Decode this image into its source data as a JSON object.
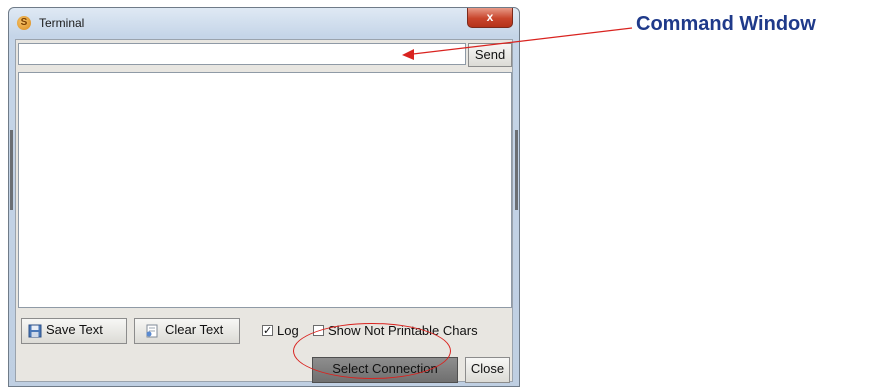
{
  "window": {
    "title": "Terminal",
    "app_icon": "terminal-app-icon",
    "close_icon_label": "x"
  },
  "command": {
    "value": "",
    "placeholder": "",
    "send_label": "Send"
  },
  "output": {
    "text": ""
  },
  "toolbar": {
    "save_label": "Save Text",
    "save_icon": "floppy-disk-icon",
    "clear_label": "Clear Text",
    "clear_icon": "clear-document-icon",
    "log_label": "Log",
    "log_checked": true,
    "show_np_label": "Show Not Printable Chars",
    "show_np_checked": false
  },
  "footer": {
    "select_label": "Select Connection",
    "close_label": "Close"
  },
  "annotation": {
    "label": "Command Window",
    "color": "#1f3a8a",
    "arrow_color": "#d9231f"
  }
}
